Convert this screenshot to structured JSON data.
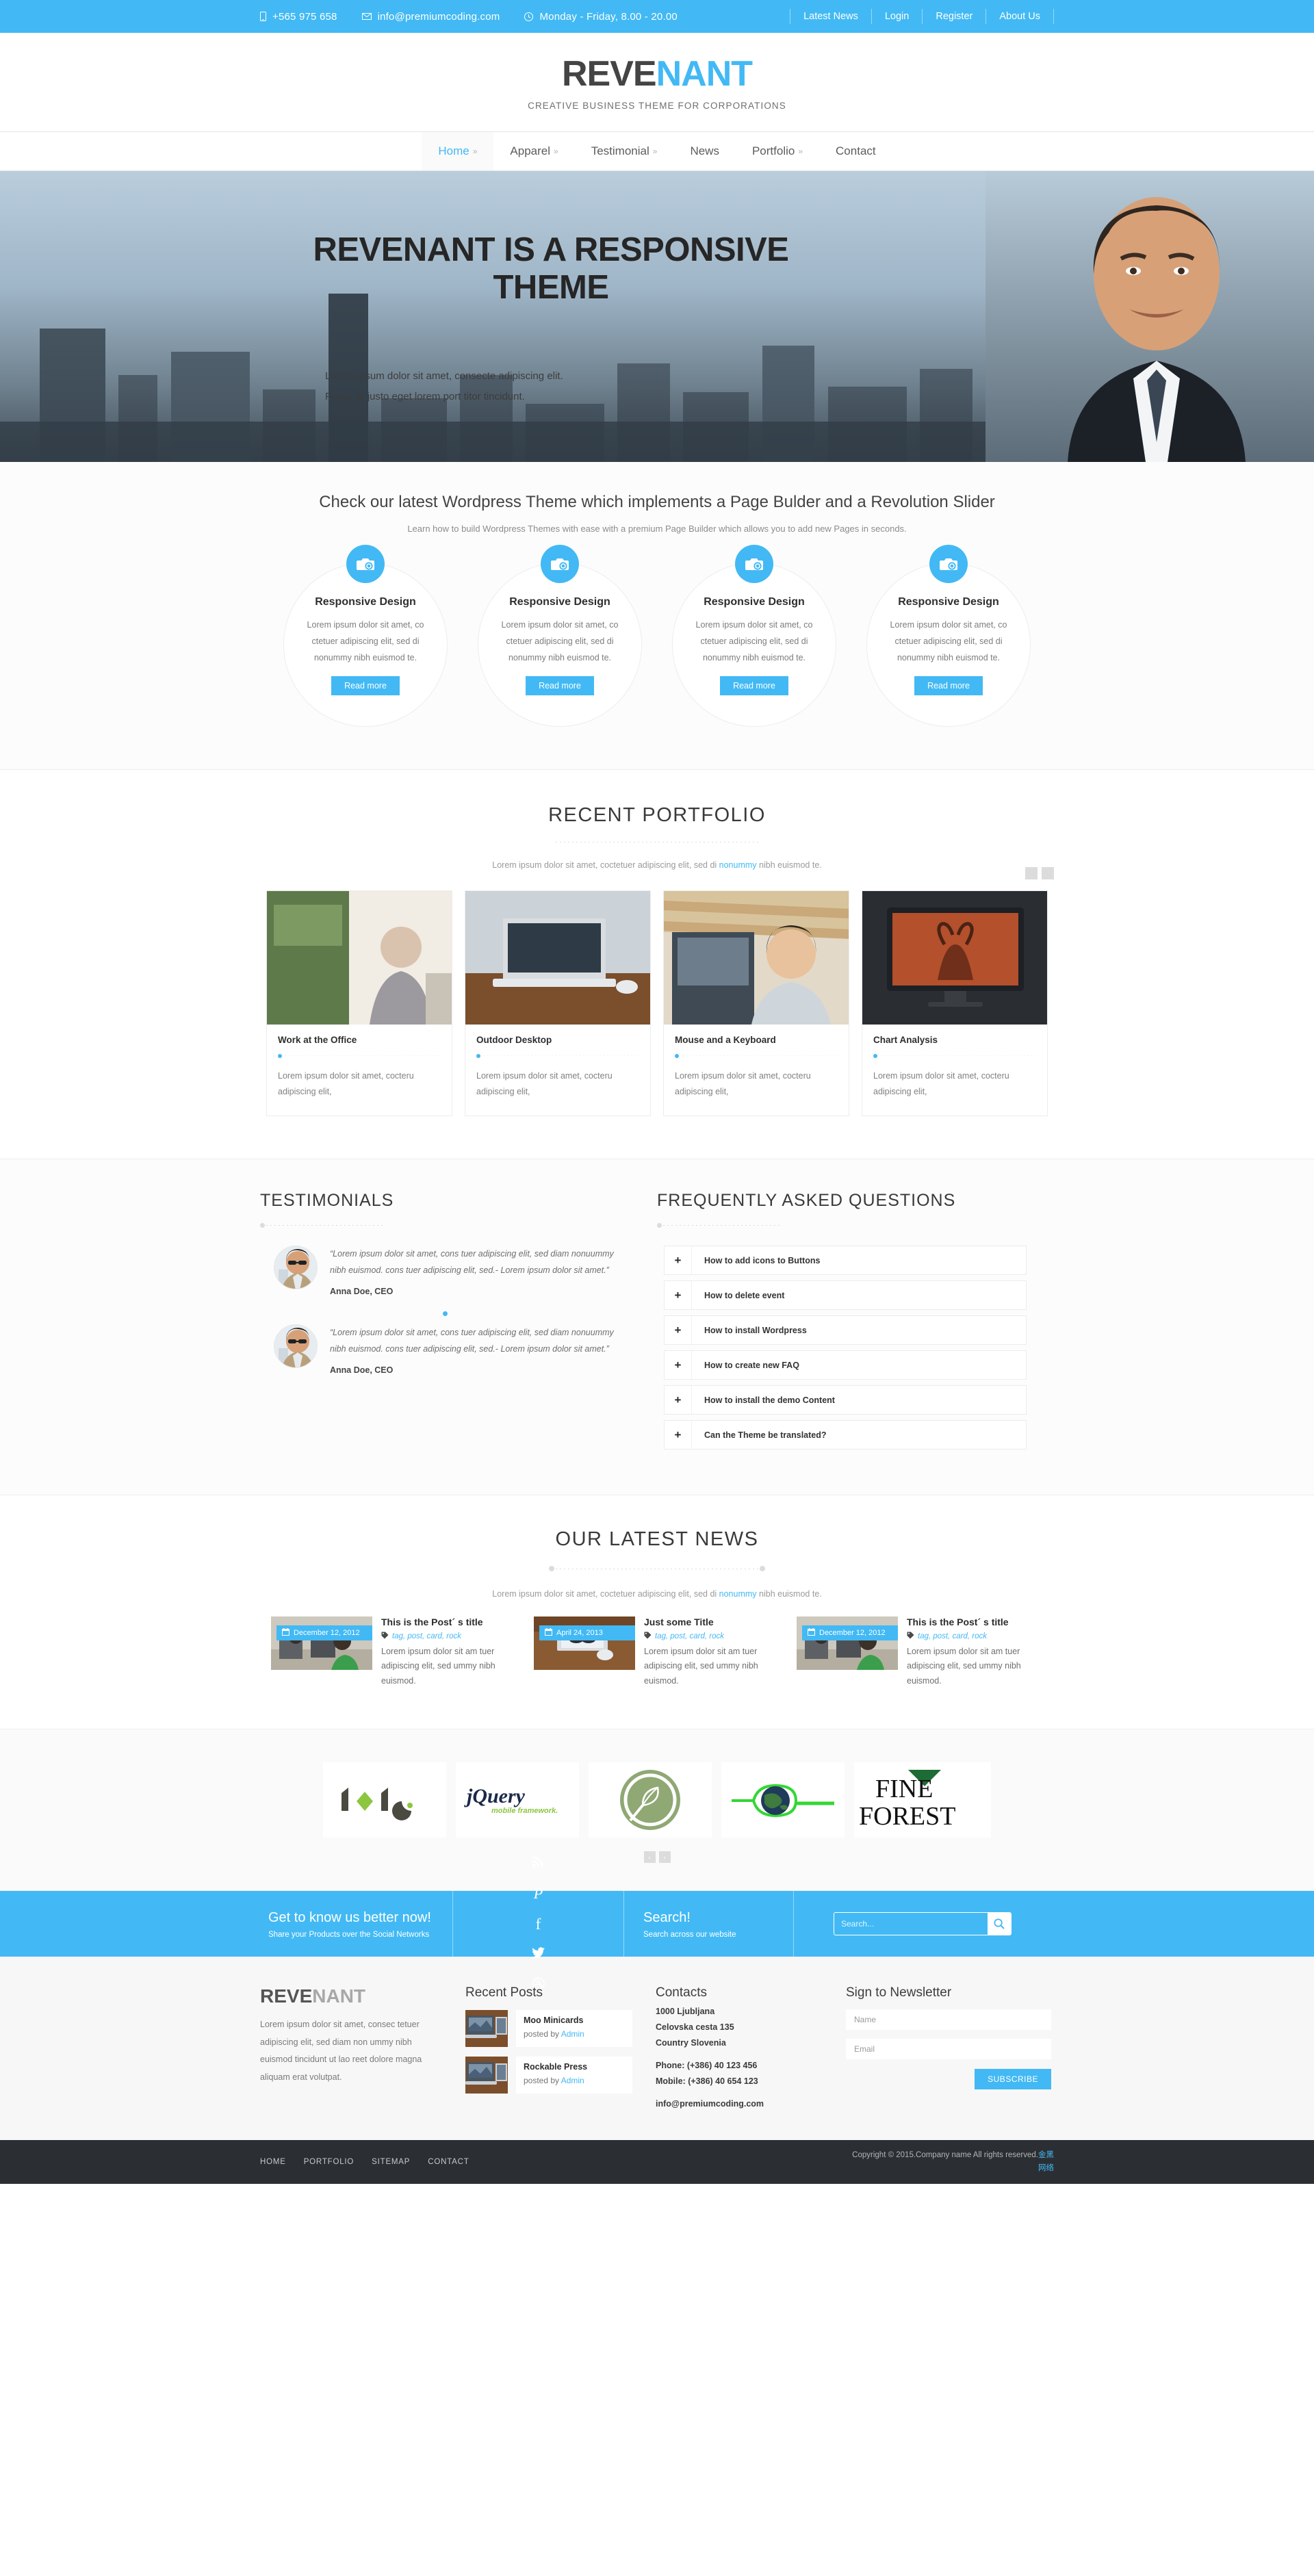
{
  "topbar": {
    "phone": "+565 975 658",
    "email": "info@premiumcoding.com",
    "hours": "Monday - Friday, 8.00 - 20.00",
    "links": [
      "Latest News",
      "Login",
      "Register",
      "About Us"
    ]
  },
  "header": {
    "logo_dark": "REVE",
    "logo_accent": "NANT",
    "tagline": "CREATIVE BUSINESS THEME FOR CORPORATIONS"
  },
  "nav": [
    {
      "label": "Home",
      "caret": "»",
      "active": true
    },
    {
      "label": "Apparel",
      "caret": "»",
      "active": false
    },
    {
      "label": "Testimonial",
      "caret": "»",
      "active": false
    },
    {
      "label": "News",
      "caret": "",
      "active": false
    },
    {
      "label": "Portfolio",
      "caret": "»",
      "active": false
    },
    {
      "label": "Contact",
      "caret": "",
      "active": false
    }
  ],
  "hero": {
    "title": "REVENANT IS A RESPONSIVE THEME",
    "text": "Lorem ipsum dolor sit amet, consecte adipiscing elit. Fusce at justo eget lorem port titor tincidunt."
  },
  "services": {
    "intro_title": "Check our latest Wordpress Theme which implements a Page Bulder and a Revolution Slider",
    "intro_sub": "Learn how to build Wordpress Themes with ease with a premium Page Builder which allows you to add new Pages in seconds.",
    "cards": [
      {
        "icon": "camera-icon",
        "title": "Responsive Design",
        "text": "Lorem ipsum dolor sit amet, co ctetuer adipiscing elit, sed di nonummy nibh euismod te.",
        "button": "Read more"
      },
      {
        "icon": "camera-icon",
        "title": "Responsive Design",
        "text": "Lorem ipsum dolor sit amet, co ctetuer adipiscing elit, sed di nonummy nibh euismod te.",
        "button": "Read more"
      },
      {
        "icon": "camera-icon",
        "title": "Responsive Design",
        "text": "Lorem ipsum dolor sit amet, co ctetuer adipiscing elit, sed di nonummy nibh euismod te.",
        "button": "Read more"
      },
      {
        "icon": "camera-icon",
        "title": "Responsive Design",
        "text": "Lorem ipsum dolor sit amet, co ctetuer adipiscing elit, sed di nonummy nibh euismod te.",
        "button": "Read more"
      }
    ]
  },
  "portfolio": {
    "title": "RECENT PORTFOLIO",
    "sub_before": "Lorem ipsum dolor sit amet, coctetuer adipiscing elit, sed di ",
    "sub_link": "nonummy",
    "sub_after": " nibh euismod te.",
    "items": [
      {
        "title": "Work at the Office",
        "text": "Lorem ipsum dolor sit amet, cocteru adipiscing elit,"
      },
      {
        "title": "Outdoor Desktop",
        "text": "Lorem ipsum dolor sit amet, cocteru adipiscing elit,"
      },
      {
        "title": "Mouse and a Keyboard",
        "text": "Lorem ipsum dolor sit amet, cocteru adipiscing elit,"
      },
      {
        "title": "Chart Analysis",
        "text": "Lorem ipsum dolor sit amet, cocteru adipiscing elit,"
      }
    ]
  },
  "testimonials": {
    "title": "TESTIMONIALS",
    "items": [
      {
        "quote": "“Lorem ipsum dolor sit amet, cons tuer adipiscing elit, sed diam nonuummy nibh euismod. cons tuer adipiscing elit, sed.- Lorem ipsum dolor sit amet.”",
        "author": "Anna Doe, CEO"
      },
      {
        "quote": "“Lorem ipsum dolor sit amet, cons tuer adipiscing elit, sed diam nonuummy nibh euismod. cons tuer adipiscing elit, sed.- Lorem ipsum dolor sit amet.”",
        "author": "Anna Doe, CEO"
      }
    ]
  },
  "faq": {
    "title": "FREQUENTLY ASKED QUESTIONS",
    "plus": "+",
    "items": [
      "How to add icons to Buttons",
      "How to delete event",
      "How to install Wordpress",
      "How to create new FAQ",
      "How to install the demo Content",
      "Can the Theme be translated?"
    ]
  },
  "news": {
    "title": "OUR LATEST NEWS",
    "sub_before": "Lorem ipsum dolor sit amet, coctetuer adipiscing elit, sed di ",
    "sub_link": "nonummy",
    "sub_after": " nibh euismod te.",
    "items": [
      {
        "date": "December 12, 2012",
        "title": "This is the Post´ s title",
        "tags": "tag, post, card, rock",
        "text": "Lorem ipsum dolor sit am tuer adipiscing elit, sed ummy nibh euismod."
      },
      {
        "date": "April 24, 2013",
        "title": "Just some Title",
        "tags": "tag, post, card, rock",
        "text": "Lorem ipsum dolor sit am tuer adipiscing elit, sed ummy nibh euismod."
      },
      {
        "date": "December 12, 2012",
        "title": "This is the Post´ s title",
        "tags": "tag, post, card, rock",
        "text": "Lorem ipsum dolor sit am tuer adipiscing elit, sed ummy nibh euismod."
      }
    ]
  },
  "clients": {
    "logos": [
      "node",
      "jQuery mobile framework.",
      "leaf-logo",
      "globe-logo",
      "FINE FOREST"
    ],
    "prev": "‹",
    "next": "›"
  },
  "strip": {
    "social_title": "Get to know us better now!",
    "social_sub": "Share your Products over the Social Networks",
    "social_icons": [
      "rss-icon",
      "pinterest-icon",
      "facebook-icon",
      "twitter-icon",
      "dribbble-icon"
    ],
    "search_title": "Search!",
    "search_sub": "Search across our website",
    "search_placeholder": "Search...",
    "search_value": "",
    "search_icon": "search-icon"
  },
  "footer": {
    "logo_dark": "REVE",
    "logo_grey": "NANT",
    "about": "Lorem ipsum dolor sit amet, consec tetuer adipiscing elit, sed diam non ummy nibh euismod tincidunt ut lao reet dolore magna aliquam erat volutpat.",
    "recent_title": "Recent Posts",
    "recent_posts": [
      {
        "title": "Moo Minicards",
        "by_prefix": "posted by ",
        "by_link": "Admin"
      },
      {
        "title": "Rockable Press",
        "by_prefix": "posted by ",
        "by_link": "Admin"
      }
    ],
    "contacts_title": "Contacts",
    "contacts": [
      "1000 Ljubljana",
      "Celovska cesta 135",
      "Country Slovenia"
    ],
    "contacts2": [
      "Phone: (+386) 40 123 456",
      "Mobile: (+386) 40 654 123"
    ],
    "contacts3": [
      "info@premiumcoding.com"
    ],
    "newsletter_title": "Sign to Newsletter",
    "name_placeholder": "Name",
    "name_value": "",
    "email_placeholder": "Email",
    "email_value": "",
    "subscribe": "SUBSCRIBE"
  },
  "bottombar": {
    "links": [
      "HOME",
      "PORTFOLIO",
      "SITEMAP",
      "CONTACT"
    ],
    "copyright": "Copyright © 2015.Company name All rights reserved.",
    "copyright_link": "金黑网络"
  },
  "colors": {
    "accent": "#42b9f4",
    "dark": "#2b2f34",
    "body_bg": "#ffffff"
  }
}
